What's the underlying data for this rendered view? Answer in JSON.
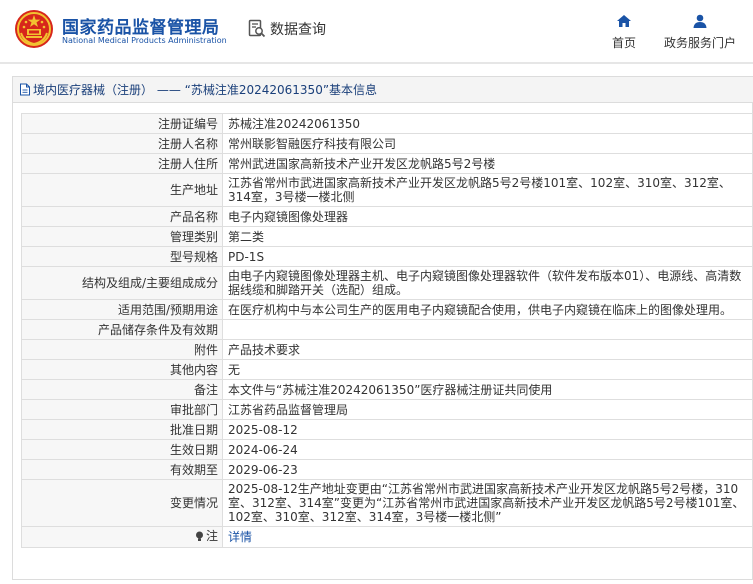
{
  "header": {
    "title_cn": "国家药品监督管理局",
    "title_en": "National Medical Products Administration",
    "query_label": "数据查询",
    "nav": {
      "home_label": "首页",
      "gov_service_label": "政务服务门户"
    }
  },
  "panel": {
    "title": "境内医疗器械（注册） —— “苏械注准20242061350”基本信息"
  },
  "rows": [
    {
      "label": "注册证编号",
      "value": "苏械注准20242061350"
    },
    {
      "label": "注册人名称",
      "value": "常州联影智融医疗科技有限公司"
    },
    {
      "label": "注册人住所",
      "value": "常州武进国家高新技术产业开发区龙帆路5号2号楼"
    },
    {
      "label": "生产地址",
      "value": "江苏省常州市武进国家高新技术产业开发区龙帆路5号2号楼101室、102室、310室、312室、314室，3号楼一楼北侧"
    },
    {
      "label": "产品名称",
      "value": "电子内窥镜图像处理器"
    },
    {
      "label": "管理类别",
      "value": "第二类"
    },
    {
      "label": "型号规格",
      "value": "PD-1S"
    },
    {
      "label": "结构及组成/主要组成成分",
      "value": "由电子内窥镜图像处理器主机、电子内窥镜图像处理器软件（软件发布版本01）、电源线、高清数据线缆和脚踏开关（选配）组成。"
    },
    {
      "label": "适用范围/预期用途",
      "value": "在医疗机构中与本公司生产的医用电子内窥镜配合使用，供电子内窥镜在临床上的图像处理用。"
    },
    {
      "label": "产品储存条件及有效期",
      "value": ""
    },
    {
      "label": "附件",
      "value": "产品技术要求"
    },
    {
      "label": "其他内容",
      "value": "无"
    },
    {
      "label": "备注",
      "value": "本文件与“苏械注准20242061350”医疗器械注册证共同使用"
    },
    {
      "label": "审批部门",
      "value": "江苏省药品监督管理局"
    },
    {
      "label": "批准日期",
      "value": "2025-08-12"
    },
    {
      "label": "生效日期",
      "value": "2024-06-24"
    },
    {
      "label": "有效期至",
      "value": "2029-06-23"
    },
    {
      "label": "变更情况",
      "value": "2025-08-12生产地址变更由“江苏省常州市武进国家高新技术产业开发区龙帆路5号2号楼，310室、312室、314室”变更为“江苏省常州市武进国家高新技术产业开发区龙帆路5号2号楼101室、102室、310室、312室、314室，3号楼一楼北侧”"
    }
  ],
  "note_row": {
    "label": "注",
    "link_text": "详情"
  },
  "icons": {
    "emblem": "national-emblem-icon",
    "query": "data-query-icon",
    "home": "home-icon",
    "user": "user-icon",
    "title": "document-icon",
    "note": "lightbulb-icon"
  },
  "colors": {
    "brand_blue": "#1a53a6",
    "emblem_red": "#d7261b",
    "emblem_gold": "#f2c230"
  }
}
